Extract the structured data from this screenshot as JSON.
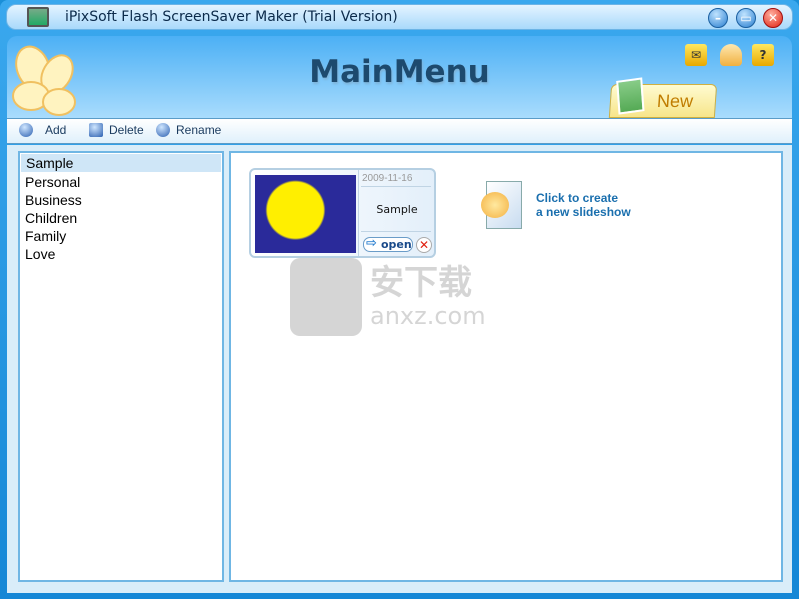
{
  "window": {
    "title": "iPixSoft Flash ScreenSaver Maker (Trial Version)",
    "controls": [
      "minimize",
      "maximize",
      "close"
    ]
  },
  "header": {
    "title": "MainMenu",
    "icons": [
      "mail-icon",
      "user-icon",
      "help-icon"
    ],
    "new_tab": "New"
  },
  "toolbar": {
    "add": "Add",
    "delete": "Delete",
    "rename": "Rename"
  },
  "categories": [
    {
      "label": "Sample",
      "selected": true
    },
    {
      "label": "Personal"
    },
    {
      "label": "Business"
    },
    {
      "label": "Children"
    },
    {
      "label": "Family"
    },
    {
      "label": "Love"
    }
  ],
  "slideshows": [
    {
      "date": "2009-11-16",
      "name": "Sample",
      "open_label": "open"
    }
  ],
  "create": {
    "line1": "Click to create",
    "line2": "a new slideshow"
  },
  "watermark": {
    "text": "安下载",
    "sub": "anxz.com"
  },
  "colors": {
    "accent": "#1587d6",
    "title": "#1d4a6e",
    "link": "#1a6fae"
  }
}
